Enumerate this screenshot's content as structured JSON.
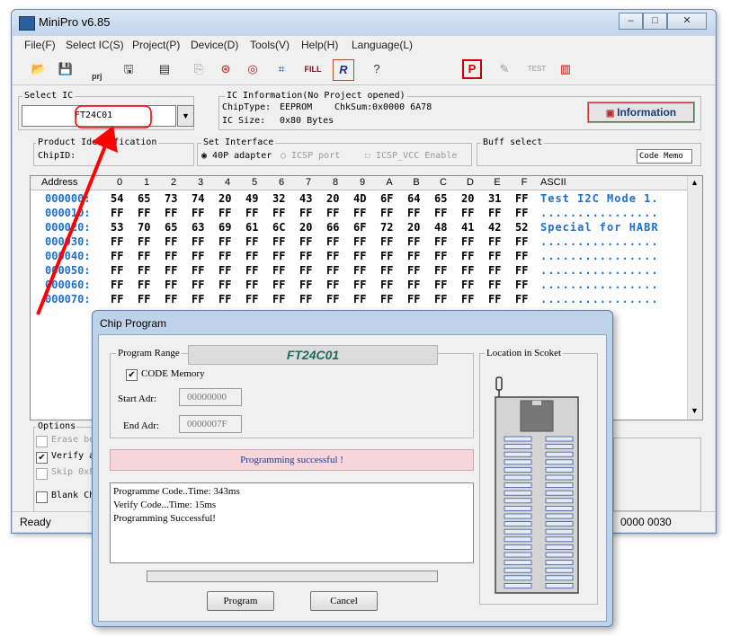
{
  "window": {
    "title": "MiniPro v6.85",
    "caption_buttons": [
      "–",
      "□",
      "✕"
    ]
  },
  "menu": [
    "File(F)",
    "Select IC(S)",
    "Project(P)",
    "Device(D)",
    "Tools(V)",
    "Help(H)",
    "Language(L)"
  ],
  "toolbar": {
    "prj_label": "prj",
    "fill_label": "FILL",
    "test_label": "TEST"
  },
  "select_ic": {
    "title": "Select IC",
    "value": "FT24C01"
  },
  "ic_info": {
    "title": "IC Information(No Project opened)",
    "chiptype_label": "ChipType:",
    "chiptype": "EEPROM",
    "chksum_label": "ChkSum:",
    "chksum": "0x0000 6A78",
    "icsize_label": "IC Size:",
    "icsize": "0x80 Bytes",
    "info_button": "Information"
  },
  "product_id": {
    "title": "Product Identification",
    "chipid_label": "ChipID:"
  },
  "set_interface": {
    "title": "Set Interface",
    "opt1": "40P adapter",
    "opt2": "ICSP port",
    "opt3": "ICSP_VCC Enable"
  },
  "buff_select": {
    "title": "Buff select",
    "value": "Code Memo"
  },
  "hex": {
    "header_address": "Address",
    "columns": [
      "0",
      "1",
      "2",
      "3",
      "4",
      "5",
      "6",
      "7",
      "8",
      "9",
      "A",
      "B",
      "C",
      "D",
      "E",
      "F"
    ],
    "header_ascii": "ASCII",
    "rows": [
      {
        "addr": "000000:",
        "bytes": [
          "54",
          "65",
          "73",
          "74",
          "20",
          "49",
          "32",
          "43",
          "20",
          "4D",
          "6F",
          "64",
          "65",
          "20",
          "31",
          "FF"
        ],
        "ascii": "Test I2C Mode 1."
      },
      {
        "addr": "000010:",
        "bytes": [
          "FF",
          "FF",
          "FF",
          "FF",
          "FF",
          "FF",
          "FF",
          "FF",
          "FF",
          "FF",
          "FF",
          "FF",
          "FF",
          "FF",
          "FF",
          "FF"
        ],
        "ascii": "................"
      },
      {
        "addr": "000020:",
        "bytes": [
          "53",
          "70",
          "65",
          "63",
          "69",
          "61",
          "6C",
          "20",
          "66",
          "6F",
          "72",
          "20",
          "48",
          "41",
          "42",
          "52"
        ],
        "ascii": "Special for HABR"
      },
      {
        "addr": "000030:",
        "bytes": [
          "FF",
          "FF",
          "FF",
          "FF",
          "FF",
          "FF",
          "FF",
          "FF",
          "FF",
          "FF",
          "FF",
          "FF",
          "FF",
          "FF",
          "FF",
          "FF"
        ],
        "ascii": "................"
      },
      {
        "addr": "000040:",
        "bytes": [
          "FF",
          "FF",
          "FF",
          "FF",
          "FF",
          "FF",
          "FF",
          "FF",
          "FF",
          "FF",
          "FF",
          "FF",
          "FF",
          "FF",
          "FF",
          "FF"
        ],
        "ascii": "................"
      },
      {
        "addr": "000050:",
        "bytes": [
          "FF",
          "FF",
          "FF",
          "FF",
          "FF",
          "FF",
          "FF",
          "FF",
          "FF",
          "FF",
          "FF",
          "FF",
          "FF",
          "FF",
          "FF",
          "FF"
        ],
        "ascii": "................"
      },
      {
        "addr": "000060:",
        "bytes": [
          "FF",
          "FF",
          "FF",
          "FF",
          "FF",
          "FF",
          "FF",
          "FF",
          "FF",
          "FF",
          "FF",
          "FF",
          "FF",
          "FF",
          "FF",
          "FF"
        ],
        "ascii": "................"
      },
      {
        "addr": "000070:",
        "bytes": [
          "FF",
          "FF",
          "FF",
          "FF",
          "FF",
          "FF",
          "FF",
          "FF",
          "FF",
          "FF",
          "FF",
          "FF",
          "FF",
          "FF",
          "FF",
          "FF"
        ],
        "ascii": "................"
      }
    ]
  },
  "options": {
    "title": "Options",
    "items": [
      {
        "label": "Erase be",
        "checked": false,
        "disabled": true
      },
      {
        "label": "Verify a",
        "checked": true,
        "disabled": false
      },
      {
        "label": "Skip 0xF",
        "checked": false,
        "disabled": true
      },
      {
        "label": "Blank Ch",
        "checked": false,
        "disabled": false
      }
    ]
  },
  "status": {
    "left": "Ready",
    "right": "0000 0030"
  },
  "dialog": {
    "title": "Chip Program",
    "program_range_title": "Program Range",
    "chip_name": "FT24C01",
    "code_memory_label": "CODE Memory",
    "start_label": "Start Adr:",
    "start_value": "00000000",
    "end_label": "End Adr:",
    "end_value": "0000007F",
    "location_title": "Location in Scoket",
    "status_message": "Programming successful !",
    "log": [
      "Programme Code..Time: 343ms",
      "Verify Code...Time: 15ms",
      "Programming Successful!"
    ],
    "progress": 0,
    "program_button": "Program",
    "cancel_button": "Cancel"
  },
  "colors": {
    "accent_red": "#ff0000",
    "hex_blue": "#1c6fd6",
    "success_bg": "#f7d5d8",
    "chip_title": "#1a6b5a"
  }
}
